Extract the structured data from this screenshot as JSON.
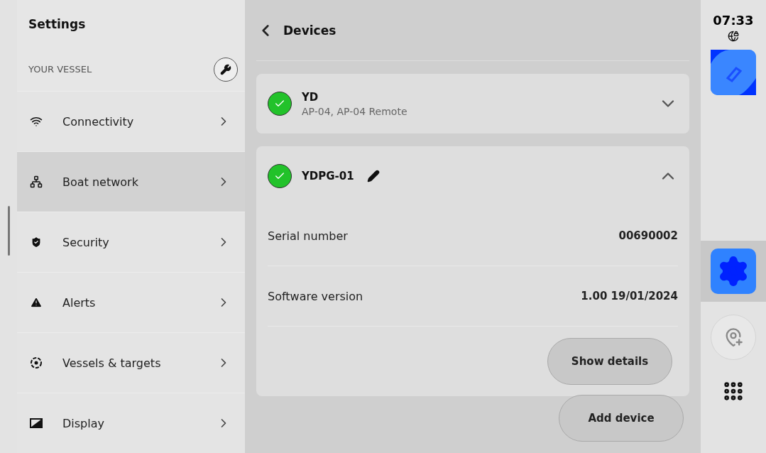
{
  "sidebar": {
    "title": "Settings",
    "section": "YOUR VESSEL",
    "items": [
      {
        "label": "Connectivity",
        "selected": false
      },
      {
        "label": "Boat network",
        "selected": true
      },
      {
        "label": "Security",
        "selected": false
      },
      {
        "label": "Alerts",
        "selected": false
      },
      {
        "label": "Vessels & targets",
        "selected": false
      },
      {
        "label": "Display",
        "selected": false
      }
    ]
  },
  "main": {
    "title": "Devices",
    "devices": [
      {
        "name": "YD",
        "subtitle": "AP-04, AP-04 Remote",
        "connected": true,
        "expanded": false,
        "editable": false
      },
      {
        "name": "YDPG-01",
        "connected": true,
        "expanded": true,
        "editable": true,
        "fields": [
          {
            "label": "Serial number",
            "value": "00690002"
          },
          {
            "label": "Software version",
            "value": "1.00 19/01/2024"
          }
        ],
        "action": "Show details"
      }
    ],
    "add_button": "Add device"
  },
  "rail": {
    "time": "07:33",
    "apps": [
      {
        "kind": "chart",
        "selected": false
      },
      {
        "kind": "settings",
        "selected": true
      }
    ]
  }
}
